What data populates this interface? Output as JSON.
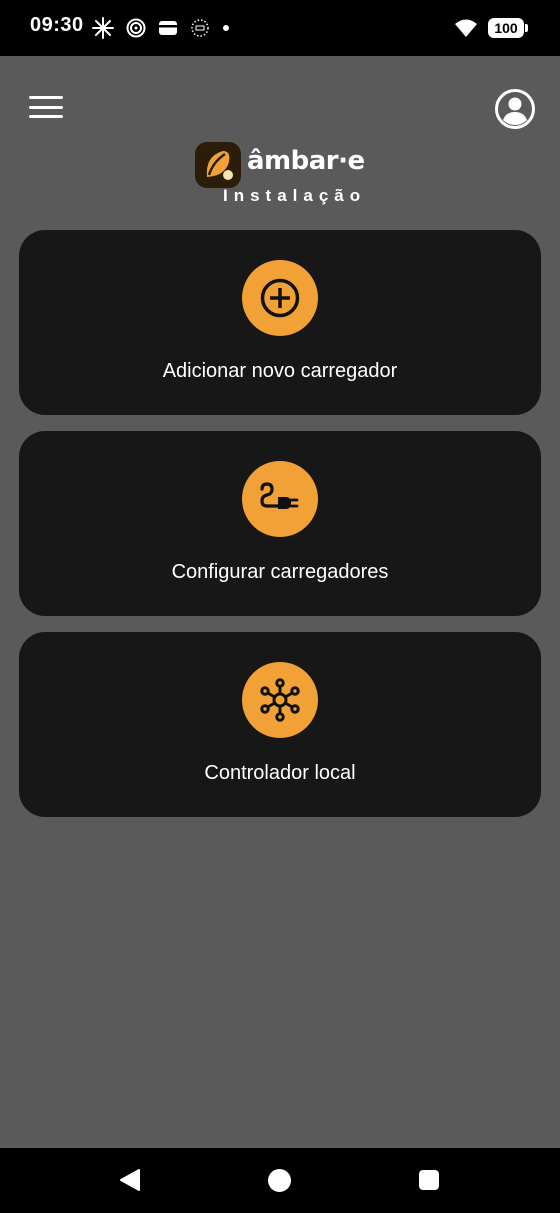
{
  "status_bar": {
    "time": "09:30",
    "battery": "100",
    "icons": [
      "starburst-icon",
      "spiral-icon",
      "wallet-icon",
      "dotted-circle-icon",
      "dot-icon",
      "wifi-icon",
      "battery-icon"
    ]
  },
  "header": {
    "brand_name": "âmbar·e",
    "brand_subtitle": "Instalação",
    "menu_icon": "hamburger-menu-icon",
    "profile_icon": "account-circle-icon"
  },
  "cards": [
    {
      "label": "Adicionar novo carregador",
      "icon": "add-circle-icon"
    },
    {
      "label": "Configurar carregadores",
      "icon": "ev-plug-icon"
    },
    {
      "label": "Controlador local",
      "icon": "hub-network-icon"
    }
  ],
  "colors": {
    "background": "#5a5a5a",
    "card": "#171717",
    "accent": "#f1a136",
    "bars": "#000000"
  },
  "nav_bar": {
    "icons": [
      "back-icon",
      "home-icon",
      "recent-apps-icon"
    ]
  }
}
